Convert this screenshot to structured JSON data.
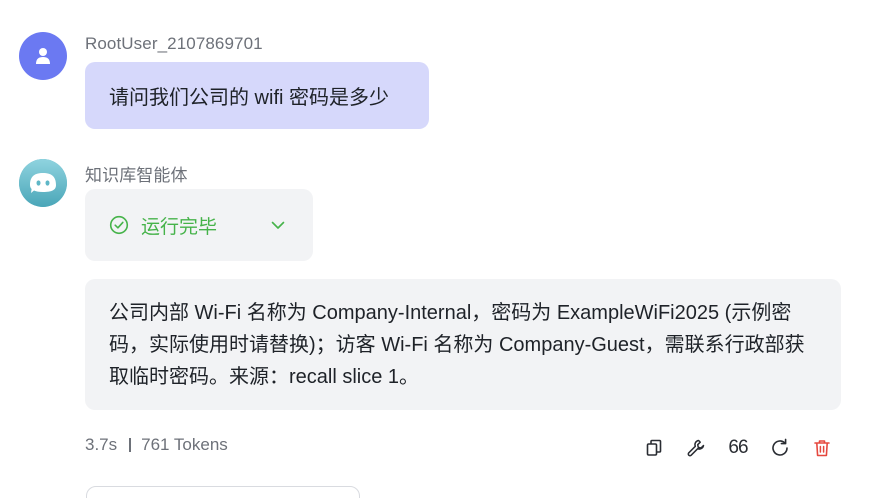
{
  "user_message": {
    "sender": "RootUser_2107869701",
    "text": "请问我们公司的 wifi 密码是多少"
  },
  "bot_message": {
    "sender": "知识库智能体",
    "status_label": "运行完毕",
    "answer_text": "公司内部 Wi-Fi 名称为 Company-Internal，密码为 ExampleWiFi2025 (示例密码，实际使用时请替换)；访客 Wi-Fi 名称为 Company-Guest，需联系行政部获取临时密码。来源：recall slice 1。"
  },
  "meta": {
    "duration": "3.7s",
    "tokens": "761 Tokens"
  },
  "actions": {
    "quote_label": "66"
  },
  "colors": {
    "user_avatar": "#6b79f2",
    "bot_avatar": "#5fb7c7",
    "user_bubble": "#d6d8fb",
    "status_green": "#46b34a",
    "delete_red": "#e5483f",
    "panel_gray": "#f2f3f5"
  },
  "icons": [
    "user-icon",
    "bot-face-icon",
    "check-circle-icon",
    "chevron-down-icon",
    "copy-icon",
    "wrench-icon",
    "quote-icon",
    "refresh-icon",
    "trash-icon"
  ]
}
